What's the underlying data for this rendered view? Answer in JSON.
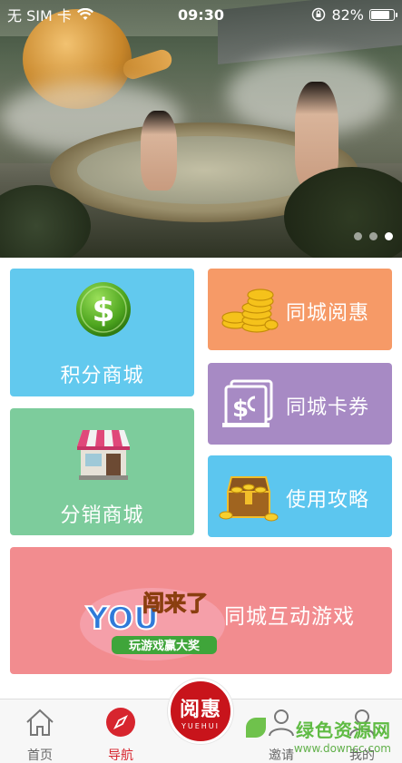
{
  "status_bar": {
    "carrier": "无 SIM 卡",
    "time": "09:30",
    "battery": "82%",
    "battery_level": 0.82
  },
  "banner": {
    "slide_count": 3,
    "active_slide": 3
  },
  "tiles": {
    "points_mall": "积分商城",
    "distribution_mall": "分销商城",
    "city_reading": "同城阅惠",
    "city_coupons": "同城卡券",
    "usage_guide": "使用攻略",
    "city_game": "同城互动游戏",
    "game_logo": {
      "line1": "YOU",
      "line2": "闯来了",
      "line3": "玩游戏赢大奖"
    }
  },
  "tabbar": {
    "home": "首页",
    "nav": "导航",
    "invite": "邀请",
    "mine": "我的",
    "active": "nav"
  },
  "center_badge": {
    "cn": "阅惠",
    "en": "YUEHUI"
  },
  "watermark": {
    "cn": "绿色资源网",
    "url": "www.downcc.com"
  },
  "colors": {
    "points_tile": "#62c9ee",
    "distribution_tile": "#7dcc9c",
    "reading_tile": "#f69a67",
    "coupon_tile": "#a78ac4",
    "guide_tile": "#5cc6ef",
    "game_tile": "#f28c8f",
    "accent_red": "#c8141b"
  }
}
